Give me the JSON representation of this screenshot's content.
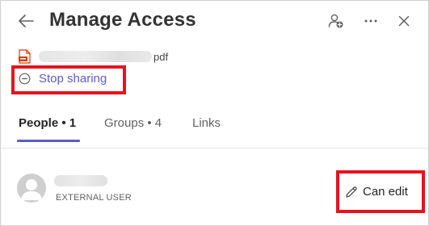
{
  "header": {
    "title": "Manage Access",
    "back_icon": "back-arrow-icon",
    "add_user_icon": "add-user-icon",
    "more_icon": "more-options-icon",
    "close_icon": "close-icon"
  },
  "file": {
    "extension": "pdf",
    "icon": "pdf-file-icon",
    "icon_color": "#d83b01"
  },
  "stop_sharing": {
    "label": "Stop sharing",
    "icon": "minus-circle-icon",
    "color": "#5b5fc7"
  },
  "tabs": [
    {
      "label": "People • 1",
      "active": true
    },
    {
      "label": "Groups • 4",
      "active": false
    },
    {
      "label": "Links",
      "active": false
    }
  ],
  "people": [
    {
      "role": "EXTERNAL USER",
      "avatar": "person-avatar-icon",
      "permission": "Can edit",
      "permission_icon": "pencil-icon"
    }
  ],
  "colors": {
    "accent": "#5b5fc7",
    "highlight_box": "#e8121e"
  }
}
